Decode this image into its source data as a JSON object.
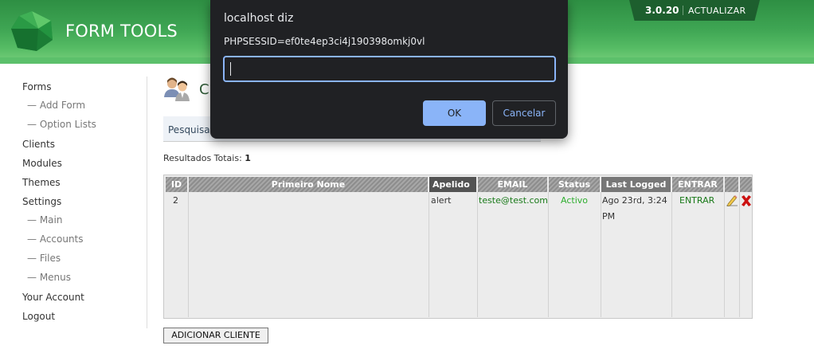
{
  "header": {
    "brand": "FORM TOOLS",
    "version": "3.0.20",
    "update_label": "ACTUALIZAR"
  },
  "sidebar": {
    "items": [
      {
        "label": "Forms",
        "sub": false
      },
      {
        "label": "— Add Form",
        "sub": true
      },
      {
        "label": "— Option Lists",
        "sub": true
      },
      {
        "label": "Clients",
        "sub": false
      },
      {
        "label": "Modules",
        "sub": false
      },
      {
        "label": "Themes",
        "sub": false
      },
      {
        "label": "Settings",
        "sub": false
      },
      {
        "label": "— Main",
        "sub": true
      },
      {
        "label": "— Accounts",
        "sub": true
      },
      {
        "label": "— Files",
        "sub": true
      },
      {
        "label": "— Menus",
        "sub": true
      },
      {
        "label": "Your Account",
        "sub": false
      },
      {
        "label": "Logout",
        "sub": false
      }
    ]
  },
  "main": {
    "title_visible": "Cl",
    "search_label": "Pesquisar",
    "results_label": "Resultados Totais:",
    "results_count": "1",
    "columns": [
      "ID",
      "Primeiro Nome",
      "Apelido ▲",
      "EMAIL",
      "Status",
      "Last Logged In",
      "ENTRAR"
    ],
    "rows": [
      {
        "id": "2",
        "first_name": "",
        "last_name": "alert",
        "email": "teste@test.com",
        "status": "Activo",
        "last_logged_line1": "Ago 23rd, 3:24",
        "last_logged_line2": "PM",
        "login": "ENTRAR"
      }
    ],
    "add_button": "ADICIONAR CLIENTE"
  },
  "dialog": {
    "title": "localhost diz",
    "message": "PHPSESSID=ef0te4ep3ci4j190398omkj0vl",
    "input_value": "",
    "ok_label": "OK",
    "cancel_label": "Cancelar"
  },
  "colors": {
    "header_green": "#3ea553",
    "dialog_bg": "#202124",
    "dialog_accent": "#8ab4f8",
    "active_status": "#2fae2f",
    "delete_red": "#cc1111"
  },
  "icons": [
    "form-tools-logo-icon",
    "clients-icon",
    "edit-pencil-icon",
    "delete-x-icon",
    "sort-asc-icon"
  ]
}
